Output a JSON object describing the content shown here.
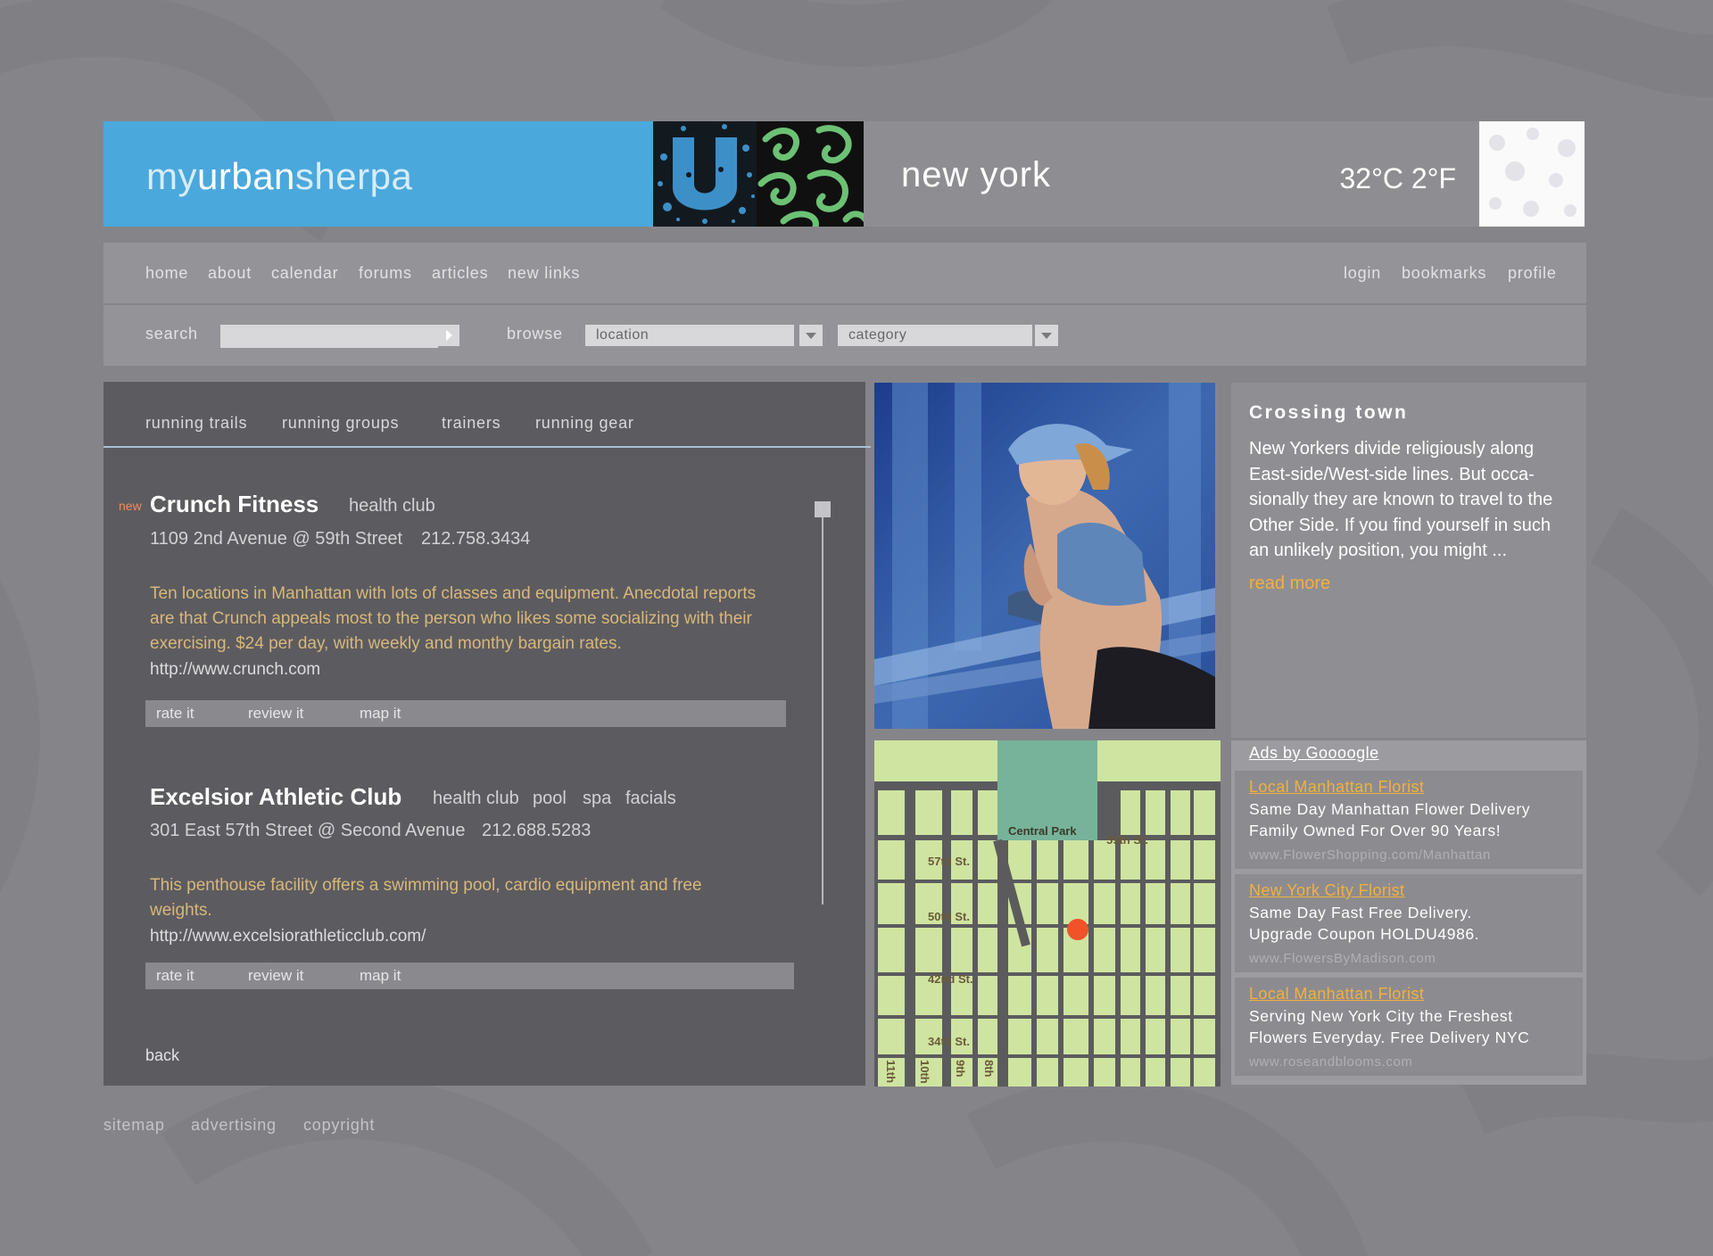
{
  "header": {
    "brand_part1": "my",
    "brand_part2": "urban",
    "brand_part3": "sherpa",
    "city": "new york",
    "temperature": "32°C 2°F"
  },
  "nav": {
    "left": [
      "home",
      "about",
      "calendar",
      "forums",
      "articles",
      "new links"
    ],
    "right": [
      "login",
      "bookmarks",
      "profile"
    ]
  },
  "search": {
    "label": "search",
    "value": "",
    "browse_label": "browse",
    "location_select": "location",
    "category_select": "category"
  },
  "tabs": [
    "running trails",
    "running groups",
    "trainers",
    "running gear"
  ],
  "listings": [
    {
      "is_new": true,
      "new_label": "new",
      "title": "Crunch Fitness",
      "tags": [
        "health club"
      ],
      "address": "1109 2nd Avenue @ 59th Street",
      "phone": "212.758.3434",
      "description_lines": [
        "Ten locations in Manhattan with lots of classes and equipment. Anecdotal reports",
        "are that Crunch appeals most to the person who likes some socializing with their",
        "exercising. $24 per day, with weekly and monthy bargain rates."
      ],
      "url": "http://www.crunch.com",
      "actions": [
        "rate it",
        "review it",
        "map it"
      ]
    },
    {
      "is_new": false,
      "title": "Excelsior Athletic Club",
      "tags": [
        "health club",
        "pool",
        "spa",
        "facials"
      ],
      "address": "301 East 57th Street @ Second Avenue",
      "phone": "212.688.5283",
      "description_lines": [
        "This penthouse facility offers a swimming pool, cardio equipment and free",
        "weights."
      ],
      "url": "http://www.excelsiorathleticclub.com/",
      "actions": [
        "rate it",
        "review it",
        "map it"
      ]
    }
  ],
  "back_label": "back",
  "map": {
    "park_label": "Central Park",
    "street_labels": [
      "59th St.",
      "57th St.",
      "50th St.",
      "42nd St.",
      "34th St."
    ],
    "avenue_labels": [
      "11th",
      "10th",
      "9th",
      "8th"
    ]
  },
  "article": {
    "title": "Crossing town",
    "body_lines": [
      "New Yorkers divide religiously along",
      "East-side/West-side lines. But occa-",
      "sionally they are known to travel to the",
      "Other Side. If you find yourself in such",
      "an unlikely position, you might ..."
    ],
    "read_more": "read more"
  },
  "ads": {
    "header": "Ads by Goooogle",
    "items": [
      {
        "title": "Local Manhattan Florist",
        "lines": [
          "Same Day Manhattan Flower Delivery",
          "Family Owned For Over 90 Years!"
        ],
        "url": "www.FlowerShopping.com/Manhattan"
      },
      {
        "title": "New York City Florist",
        "lines": [
          "Same Day Fast Free Delivery.",
          "Upgrade Coupon HOLDU4986."
        ],
        "url": "www.FlowersByMadison.com"
      },
      {
        "title": "Local Manhattan Florist",
        "lines": [
          "Serving New York City the Freshest",
          "Flowers Everyday. Free Delivery NYC"
        ],
        "url": "www.roseandblooms.com"
      }
    ]
  },
  "footer": [
    "sitemap",
    "advertising",
    "copyright"
  ],
  "colors": {
    "brand_blue": "#4aa8dc",
    "panel_dark": "#5c5c60",
    "accent_orange": "#f4b03c",
    "map_green": "#cfe4a0",
    "park_teal": "#77b39a",
    "map_marker": "#f0522a"
  }
}
